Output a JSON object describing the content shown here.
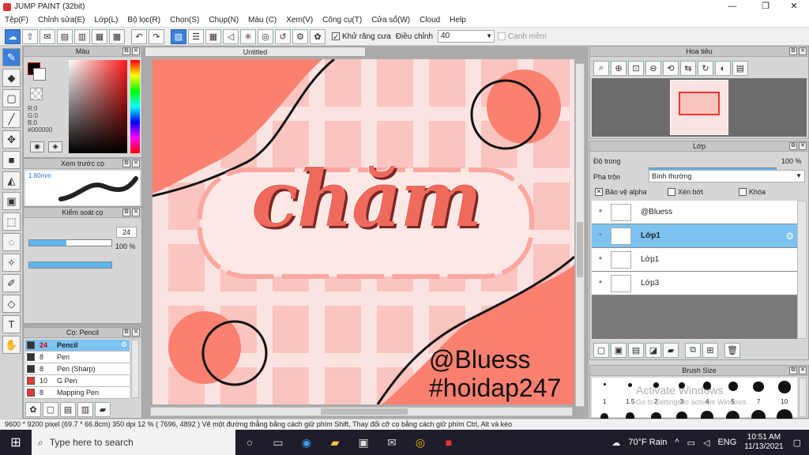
{
  "window": {
    "title": "JUMP PAINT (32bit)",
    "minimize": "—",
    "maximize": "❐",
    "close": "✕"
  },
  "menu": [
    "Tệp(F)",
    "Chỉnh sửa(E)",
    "Lớp(L)",
    "Bộ lọc(R)",
    "Chọn(S)",
    "Chụp(N)",
    "Màu (C)",
    "Xem(V)",
    "Công cụ(T)",
    "Cửa sổ(W)",
    "Cloud",
    "Help"
  ],
  "toolbar": {
    "antialias_label": "Khử răng cưa",
    "adjust_label": "Điều chỉnh",
    "adjust_value": "40",
    "snap_label": "Canh mềm"
  },
  "color_panel": {
    "title": "Màu",
    "r": "R:0",
    "g": "G:0",
    "b": "B:0",
    "hex": "#000000",
    "fg": "#000000",
    "bg": "#ffffff"
  },
  "brush_preview": {
    "title": "Xem trước cọ",
    "size": "1.80mm"
  },
  "brush_control": {
    "title": "Kiểm soát cọ",
    "size_value": "24",
    "size_fill": 0.45,
    "opacity_value": "100 %",
    "opacity_fill": 1.0
  },
  "brush_list": {
    "title": "Cọ: Pencil",
    "items": [
      {
        "size": "24",
        "name": "Pencil",
        "color": "#333333",
        "selected": true
      },
      {
        "size": "8",
        "name": "Pen",
        "color": "#333333",
        "selected": false
      },
      {
        "size": "8",
        "name": "Pen (Sharp)",
        "color": "#333333",
        "selected": false
      },
      {
        "size": "10",
        "name": "G Pen",
        "color": "#e53935",
        "selected": false
      },
      {
        "size": "8",
        "name": "Mapping Pen",
        "color": "#e53935",
        "selected": false
      }
    ]
  },
  "document": {
    "tab": "Untitled"
  },
  "artwork": {
    "title_text": "chăm",
    "handle": "@Bluess",
    "tag": "#hoidap247",
    "colors": {
      "coral": "#fb8070",
      "pink": "#fbc4bf",
      "light": "#fbe3e1",
      "text": "#111111"
    }
  },
  "navigator": {
    "title": "Hoa tiêu"
  },
  "layer_panel": {
    "title": "Lớp",
    "opacity_label": "Độ trong",
    "opacity_value": "100 %",
    "opacity_fill": 1.0,
    "blend_label": "Pha trộn",
    "blend_value": "Bình thường",
    "protect_alpha": "Bảo vệ alpha",
    "clipping": "Xén bớt",
    "lock": "Khóa",
    "layers": [
      {
        "name": "@Bluess",
        "selected": false
      },
      {
        "name": "Lớp1",
        "selected": true
      },
      {
        "name": "Lớp1",
        "selected": false
      },
      {
        "name": "Lớp3",
        "selected": false
      }
    ]
  },
  "brush_size_panel": {
    "title": "Brush Size",
    "labels": [
      "1",
      "1.5",
      "2",
      "3",
      "4",
      "5",
      "7",
      "10"
    ],
    "watermark_1": "Activate Windows",
    "watermark_2": "Go to Settings to activate Windows."
  },
  "status": {
    "text": "9600 * 9200 pixel  (69.7 * 66.8cm)  350 dpi   12 %  ( 7696, 4892 )  Vẽ một đường thẳng bằng cách giữ phím Shift, Thay đổi cỡ cọ bằng cách giữ phím Ctrl, Alt và kéo"
  },
  "taskbar": {
    "search_placeholder": "Type here to search",
    "weather": "70°F  Rain",
    "lang": "ENG",
    "time": "10:51 AM",
    "date": "11/13/2021"
  }
}
